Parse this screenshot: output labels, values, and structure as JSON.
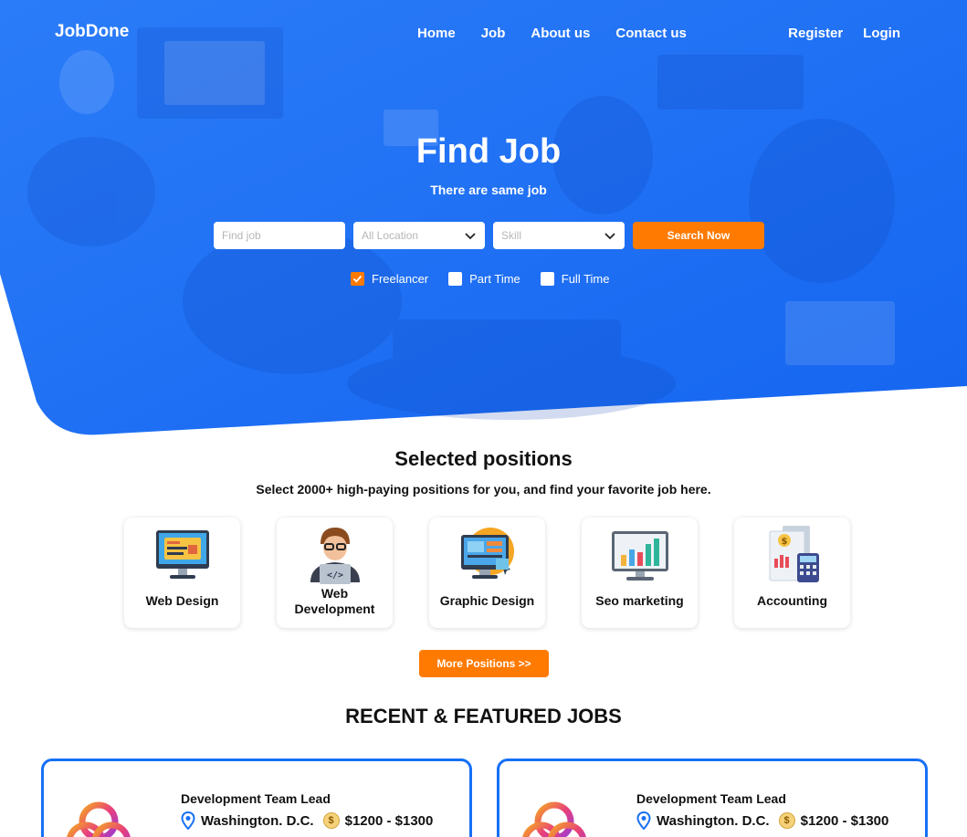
{
  "nav": {
    "logo": "JobDone",
    "links": [
      "Home",
      "Job",
      "About us",
      "Contact us"
    ],
    "register": "Register",
    "login": "Login"
  },
  "hero": {
    "title": "Find Job",
    "subtitle": "There are same job",
    "search": {
      "job_placeholder": "Find job",
      "location_value": "All Location",
      "skill_value": "Skill",
      "button": "Search Now"
    },
    "filters": [
      {
        "label": "Freelancer",
        "checked": true
      },
      {
        "label": "Part Time",
        "checked": false
      },
      {
        "label": "Full Time",
        "checked": false
      }
    ]
  },
  "positions": {
    "title": "Selected positions",
    "subtitle": "Select 2000+ high-paying positions for you, and find your favorite job here.",
    "categories": [
      {
        "label": "Web Design",
        "icon": "web-design-icon"
      },
      {
        "label": "Web Development",
        "icon": "developer-icon"
      },
      {
        "label": "Graphic Design",
        "icon": "graphic-design-icon"
      },
      {
        "label": "Seo marketing",
        "icon": "chart-monitor-icon"
      },
      {
        "label": "Accounting",
        "icon": "accounting-icon"
      }
    ],
    "more_button": "More Positions >>"
  },
  "recent": {
    "title": "RECENT & FEATURED JOBS",
    "jobs": [
      {
        "title": "Development Team Lead",
        "location": "Washington. D.C.",
        "salary": "$1200 - $1300"
      },
      {
        "title": "Development Team Lead",
        "location": "Washington. D.C.",
        "salary": "$1200 - $1300"
      }
    ]
  },
  "colors": {
    "primary": "#1670f5",
    "accent": "#ff7a00"
  }
}
